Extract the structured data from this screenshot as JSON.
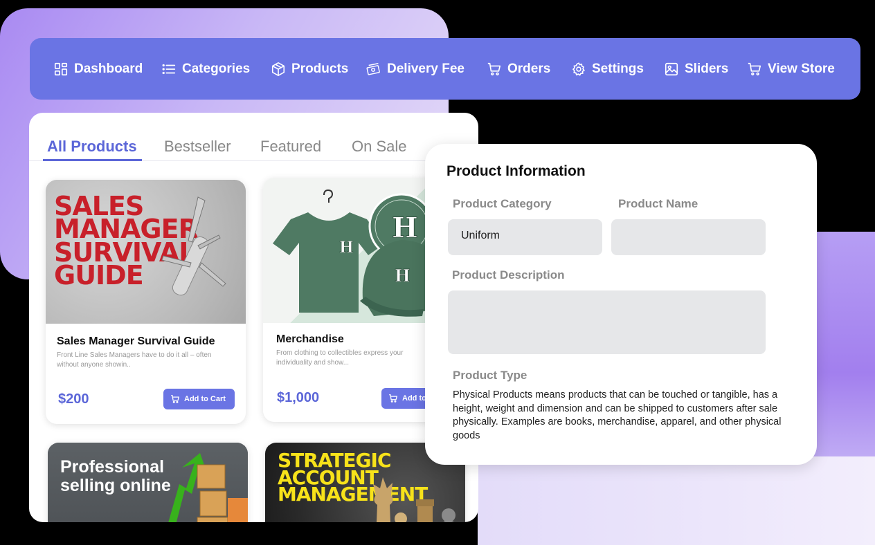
{
  "nav": {
    "items": [
      {
        "label": "Dashboard",
        "icon": "dashboard-icon"
      },
      {
        "label": "Categories",
        "icon": "list-icon"
      },
      {
        "label": "Products",
        "icon": "box-icon"
      },
      {
        "label": "Delivery Fee",
        "icon": "cash-icon"
      },
      {
        "label": "Orders",
        "icon": "cart-icon"
      },
      {
        "label": "Settings",
        "icon": "gear-icon"
      },
      {
        "label": "Sliders",
        "icon": "image-icon"
      },
      {
        "label": "View Store",
        "icon": "cart-icon"
      }
    ]
  },
  "tabs": [
    "All Products",
    "Bestseller",
    "Featured",
    "On Sale"
  ],
  "products": [
    {
      "poster": "SALES MANAGER SURVIVAL GUIDE",
      "title": "Sales Manager Survival Guide",
      "desc": "Front Line Sales Managers have to do it all – often without anyone showin..",
      "price": "$200",
      "button": "Add to Cart"
    },
    {
      "poster": "H",
      "title": "Merchandise",
      "desc": "From clothing to collectibles express your individuality and show...",
      "price": "$1,000",
      "button": "Add to Cart"
    },
    {
      "poster": "Professional selling online"
    },
    {
      "poster": "STRATEGIC ACCOUNT MANAGEMENT"
    }
  ],
  "info": {
    "heading": "Product Information",
    "category_label": "Product Category",
    "category_value": "Uniform",
    "name_label": "Product Name",
    "name_value": "",
    "description_label": "Product Description",
    "description_value": "",
    "type_label": "Product Type",
    "type_text": "Physical Products means products that can be touched or tangible, has a height, weight and dimension and can be shipped to customers after sale physically. Examples are books, merchandise, apparel, and other physical goods"
  },
  "colors": {
    "accent": "#6a74e4",
    "accent_text": "#5b66d8",
    "poster_red": "#c8202a",
    "poster_yellow": "#f7e21a",
    "merch_green": "#4f7a63"
  }
}
